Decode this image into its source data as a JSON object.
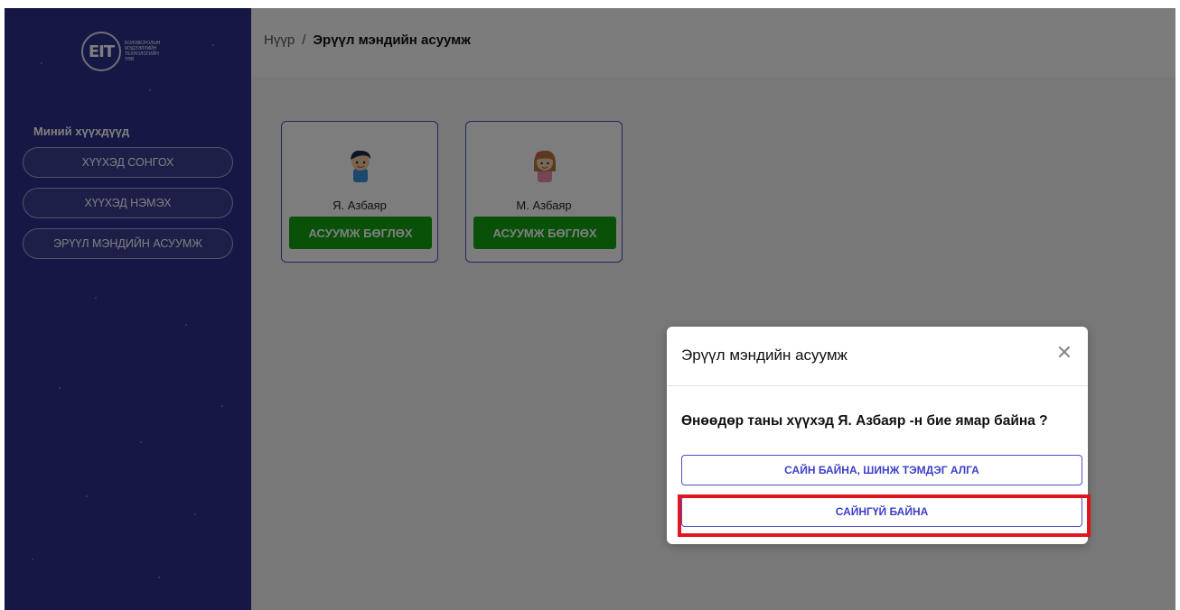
{
  "logo": {
    "mark": "EIT",
    "text_lines": [
      "Боловсролын",
      "мэдээллийн",
      "технологийн",
      "төв"
    ]
  },
  "sidebar": {
    "title": "Миний хүүхдүүд",
    "items": [
      {
        "label": "ХҮҮХЭД СОНГОХ"
      },
      {
        "label": "ХҮҮХЭД НЭМЭХ"
      },
      {
        "label": "ЭРҮҮЛ МЭНДИЙН АСУУМЖ"
      }
    ]
  },
  "breadcrumb": {
    "home": "Нүүр",
    "separator": "/",
    "current": "Эрүүл мэндийн асуумж"
  },
  "children": [
    {
      "name": "Я. Азбаяр",
      "avatar_icon": "boy-avatar-icon",
      "button_label": "АСУУМЖ БӨГЛӨХ"
    },
    {
      "name": "М. Азбаяр",
      "avatar_icon": "girl-avatar-icon",
      "button_label": "АСУУМЖ БӨГЛӨХ"
    }
  ],
  "modal": {
    "title": "Эрүүл мэндийн асуумж",
    "close_icon": "close-icon",
    "question": "Өнөөдөр таны хүүхэд Я. Азбаяр -н бие ямар байна ?",
    "answers": [
      {
        "label": "САЙН БАЙНА, ШИНЖ ТЭМДЭГ АЛГА"
      },
      {
        "label": "САЙНГҮЙ БАЙНА"
      }
    ]
  },
  "colors": {
    "sidebar": "#2a2f8a",
    "survey_button": "#12a012",
    "accent": "#3b41c9",
    "highlight": "#e0151e"
  }
}
